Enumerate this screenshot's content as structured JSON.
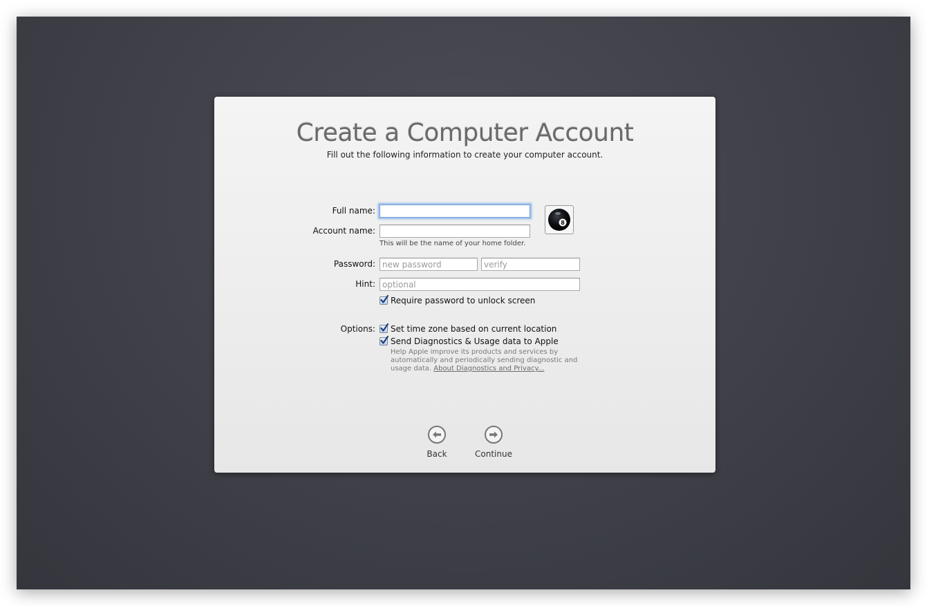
{
  "dialog": {
    "title": "Create a Computer Account",
    "subtitle": "Fill out the following information to create your computer account."
  },
  "form": {
    "full_name": {
      "label": "Full name:",
      "value": ""
    },
    "account_name": {
      "label": "Account name:",
      "value": "",
      "note": "This will be the name of your home folder."
    },
    "password": {
      "label": "Password:",
      "placeholder": "new password",
      "verify_placeholder": "verify"
    },
    "hint": {
      "label": "Hint:",
      "placeholder": "optional"
    },
    "require_password": {
      "label": "Require password to unlock screen",
      "checked": true
    },
    "user_picture": {
      "icon": "eight-ball-icon"
    }
  },
  "options": {
    "label": "Options:",
    "time_zone": {
      "label": "Set time zone based on current location",
      "checked": true
    },
    "diagnostics": {
      "label": "Send Diagnostics & Usage data to Apple",
      "checked": true,
      "help": "Help Apple improve its products and services by automatically and periodically sending diagnostic and usage data.",
      "link": "About Diagnostics and Privacy..."
    }
  },
  "navigation": {
    "back": {
      "label": "Back",
      "icon": "arrow-left-circle-icon"
    },
    "continue": {
      "label": "Continue",
      "icon": "arrow-right-circle-icon"
    }
  },
  "colors": {
    "background": "#41424a",
    "dialog": "#efefef",
    "focus_ring": "#8fb6e6",
    "checkbox_check": "#1e3f7a"
  }
}
